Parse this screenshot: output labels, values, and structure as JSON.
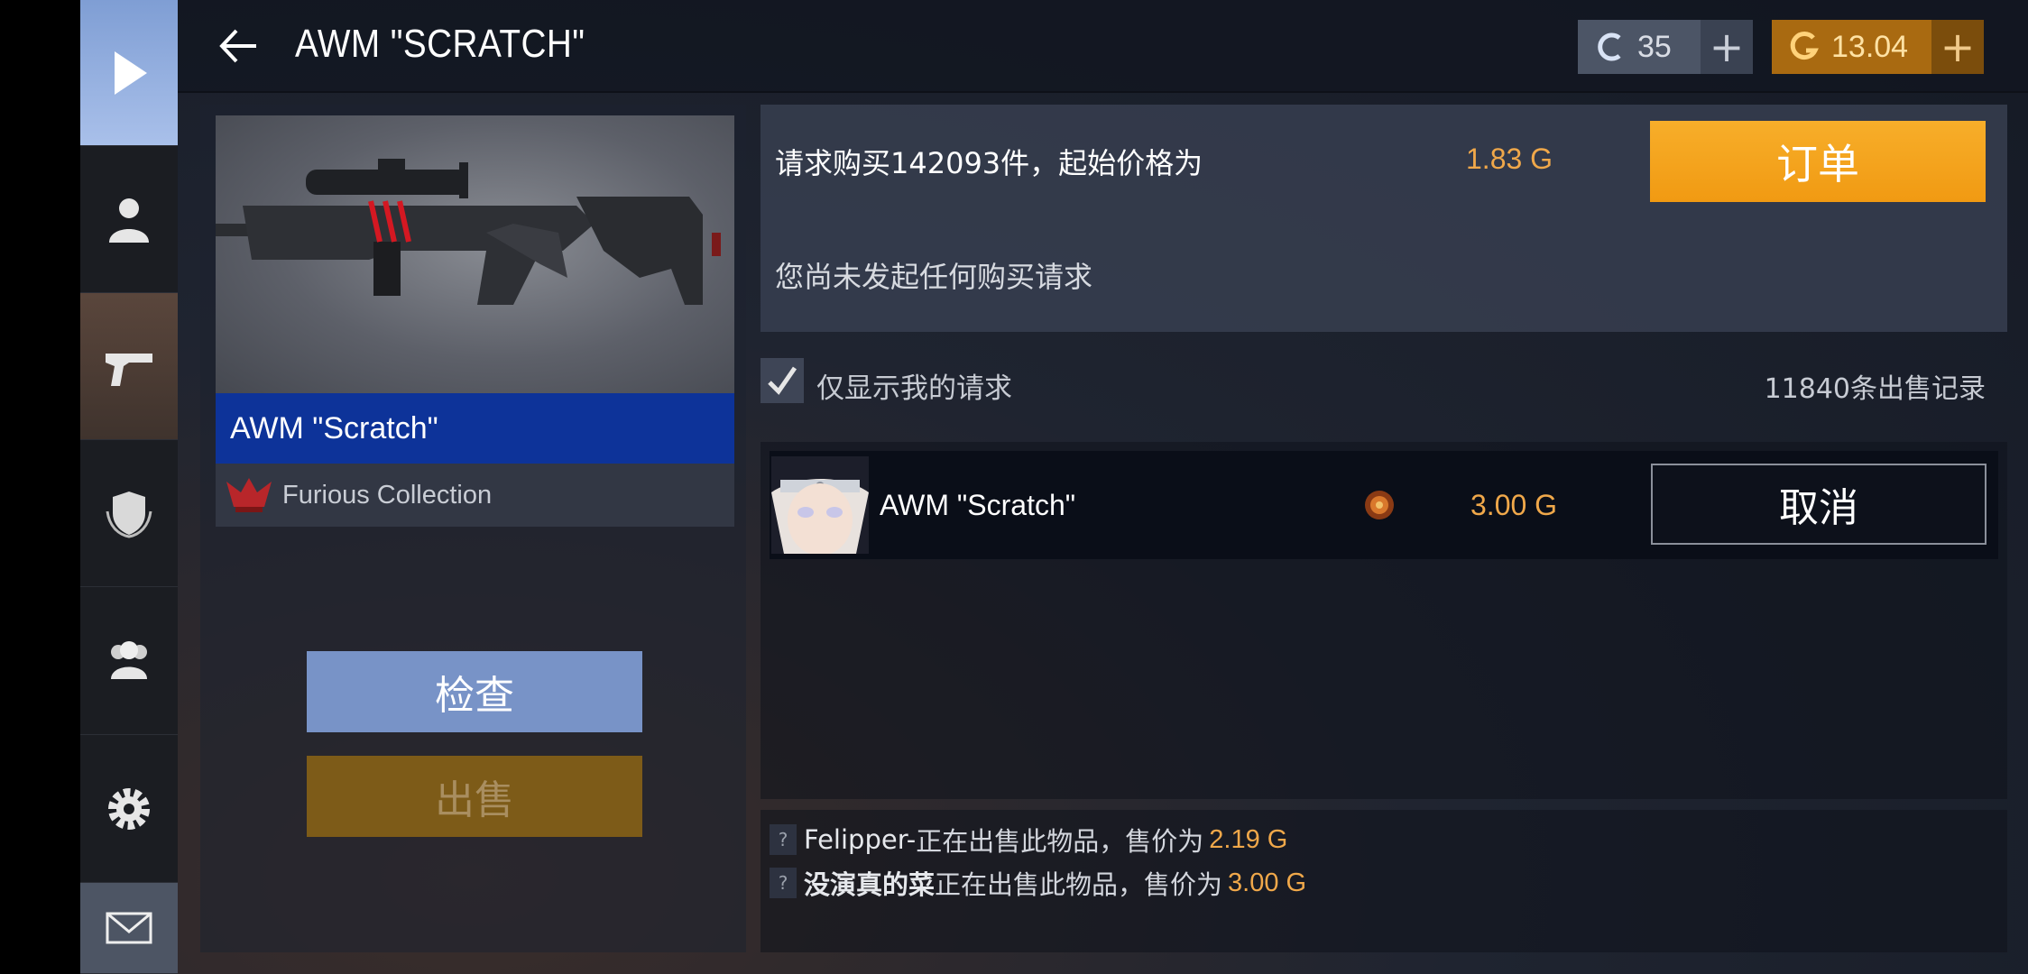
{
  "header": {
    "title": "AWM \"SCRATCH\"",
    "credits": "35",
    "gold": "13.04"
  },
  "sidebar": {
    "items": [
      "play",
      "profile",
      "weapons",
      "rank",
      "friends",
      "settings",
      "mail"
    ]
  },
  "item": {
    "name": "AWM \"Scratch\"",
    "collection": "Furious Collection"
  },
  "left_buttons": {
    "inspect": "检查",
    "sell": "出售"
  },
  "order": {
    "request_text": "请求购买142093件，起始价格为",
    "start_price": "1.83 G",
    "order_button": "订单",
    "no_requests": "您尚未发起任何购买请求"
  },
  "filter": {
    "label": "仅显示我的请求",
    "records": "11840条出售记录"
  },
  "listings": [
    {
      "name": "AWM \"Scratch\"",
      "price": "3.00 G",
      "action": "取消"
    }
  ],
  "activity": [
    {
      "user": "Felipper-",
      "text": "正在出售此物品，售价为",
      "price": "2.19 G"
    },
    {
      "user": "没演真的菜",
      "text": "正在出售此物品，售价为",
      "price": "3.00 G"
    }
  ],
  "colors": {
    "gold_accent": "#f0a84a",
    "order_button": "#f5a21e",
    "name_bar": "#0d3399",
    "inspect_button": "#7893c7",
    "sell_button": "#7d5b18"
  }
}
